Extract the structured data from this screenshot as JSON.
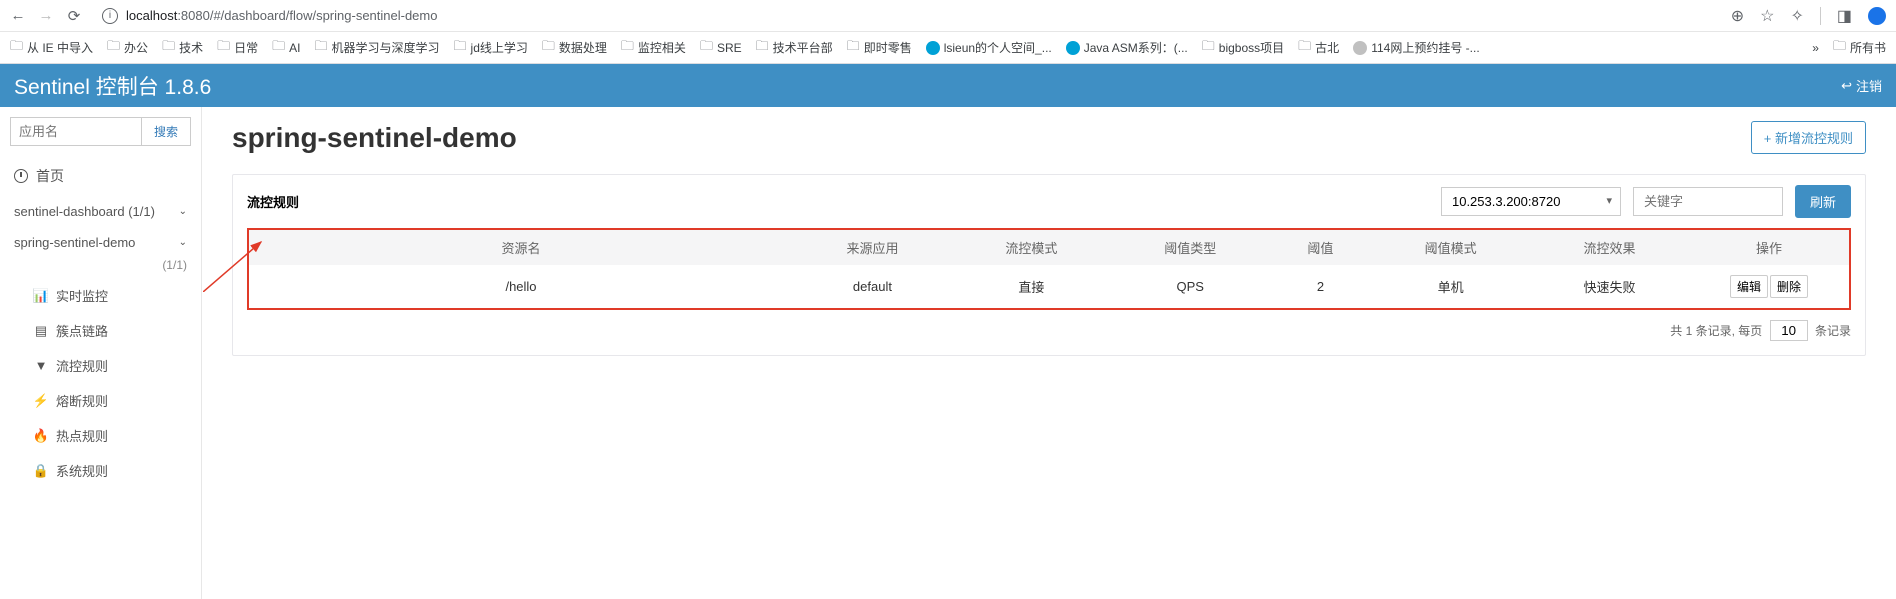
{
  "browser": {
    "url_host": "localhost",
    "url_rest": ":8080/#/dashboard/flow/spring-sentinel-demo"
  },
  "bookmarks": {
    "items": [
      "从 IE 中导入",
      "办公",
      "技术",
      "日常",
      "AI",
      "机器学习与深度学习",
      "jd线上学习",
      "数据处理",
      "监控相关",
      "SRE",
      "技术平台部",
      "即时零售"
    ],
    "bili": "lsieun的个人空间_...",
    "asm": "Java ASM系列：(...",
    "tail": [
      "bigboss项目",
      "古北"
    ],
    "gray": "114网上预约挂号 -...",
    "all": "所有书"
  },
  "header": {
    "title": "Sentinel 控制台 1.8.6",
    "logout": "注销"
  },
  "sidebar": {
    "search_placeholder": "应用名",
    "search_btn": "搜索",
    "home": "首页",
    "apps": [
      {
        "name": "sentinel-dashboard",
        "count": "(1/1)"
      },
      {
        "name": "spring-sentinel-demo",
        "count": "(1/1)"
      }
    ],
    "submenu": [
      "实时监控",
      "簇点链路",
      "流控规则",
      "熔断规则",
      "热点规则",
      "系统规则"
    ]
  },
  "main": {
    "title": "spring-sentinel-demo",
    "add_btn": "+  新增流控规则",
    "panel_title": "流控规则",
    "machine_select": "10.253.3.200:8720",
    "keyword_placeholder": "关键字",
    "refresh": "刷新",
    "columns": [
      "资源名",
      "来源应用",
      "流控模式",
      "阈值类型",
      "阈值",
      "阈值模式",
      "流控效果",
      "操作"
    ],
    "row": {
      "resource": "/hello",
      "app": "default",
      "mode": "直接",
      "type": "QPS",
      "threshold": "2",
      "tmode": "单机",
      "effect": "快速失败"
    },
    "edit": "编辑",
    "delete": "删除",
    "pager_pre": "共 1 条记录, 每页",
    "pager_size": "10",
    "pager_post": "条记录"
  }
}
